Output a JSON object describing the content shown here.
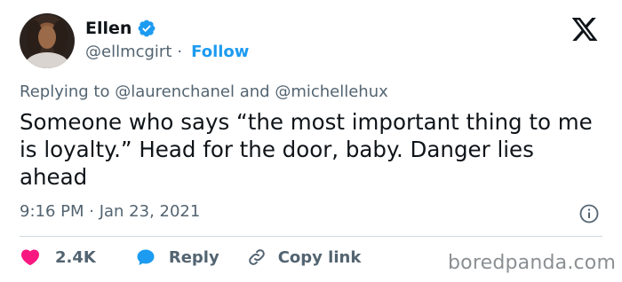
{
  "author": {
    "display_name": "Ellen",
    "handle": "@ellmcgirt",
    "separator": "·",
    "follow_label": "Follow",
    "verified_color": "#1d9bf0"
  },
  "reply_context": {
    "prefix": "Replying to",
    "mention_1": "@laurenchanel",
    "conjunction": "and",
    "mention_2": "@michellehux"
  },
  "tweet": {
    "text": "Someone who says “the most important thing to me is loyalty.” Head for the door, baby. Danger lies ahead",
    "timestamp": "9:16 PM · Jan 23, 2021"
  },
  "actions": {
    "like_count": "2.4K",
    "reply_label": "Reply",
    "copy_label": "Copy link"
  },
  "icons": {
    "x_logo": "x-logo-icon",
    "verified": "verified-badge-icon",
    "info": "info-icon",
    "heart": "heart-icon",
    "reply": "reply-bubble-icon",
    "link": "link-icon"
  },
  "colors": {
    "text": "#0f1419",
    "secondary": "#536471",
    "accent": "#1d9bf0",
    "like": "#f91880",
    "watermark": "#8a8f93"
  },
  "watermark": {
    "text": "boredpanda.com"
  }
}
